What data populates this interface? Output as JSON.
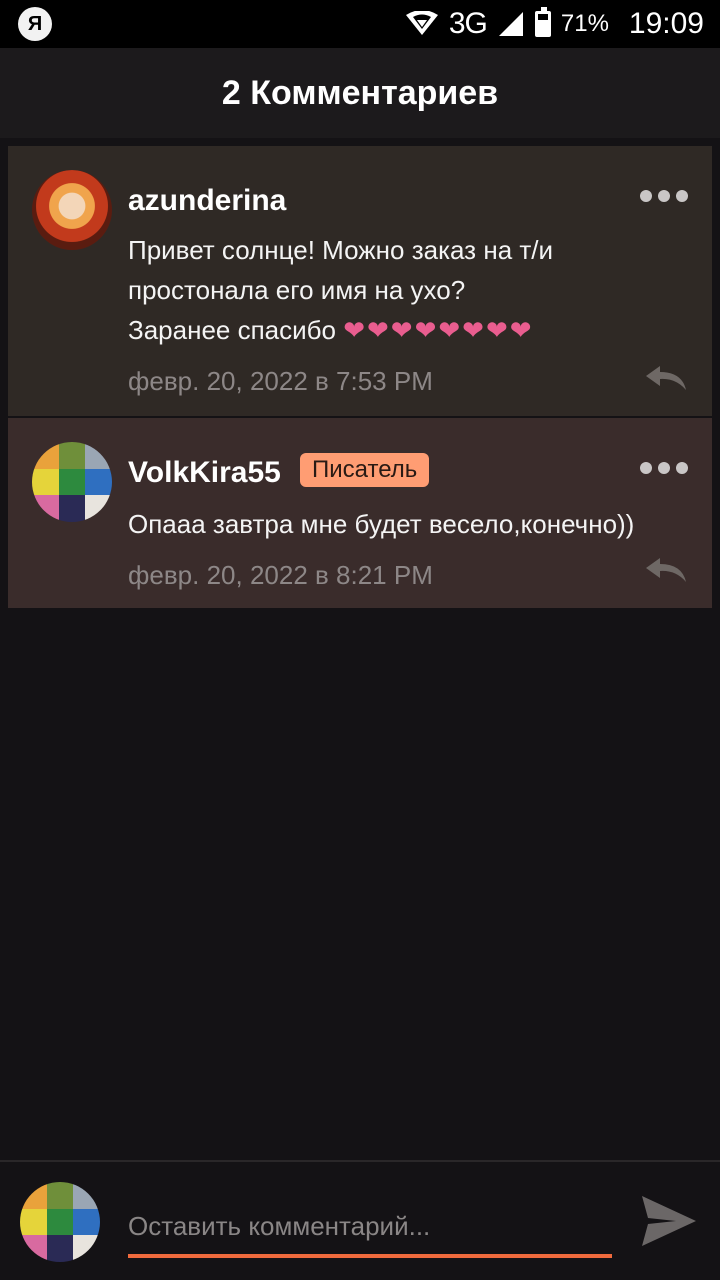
{
  "status_bar": {
    "app_icon_letter": "Я",
    "network": "3G",
    "battery": "71%",
    "time": "19:09"
  },
  "header": {
    "title": "2 Комментариев"
  },
  "comments": [
    {
      "username": "azunderina",
      "text_lines": [
        "Привет солнце! Можно заказ на т/и",
        "простонала его имя на ухо?",
        "Заранее спасибо"
      ],
      "hearts": "❤❤❤❤❤❤❤❤",
      "date": "февр. 20, 2022 в 7:53 PM"
    },
    {
      "username": "VolkKira55",
      "badge": "Писатель",
      "text_lines": [
        "Опааа завтра мне будет весело,конечно))"
      ],
      "date": "февр. 20, 2022 в 8:21 PM"
    }
  ],
  "input": {
    "placeholder": "Оставить комментарий..."
  },
  "colors": {
    "accent": "#f06a3d",
    "badge": "#ff9d73",
    "heart": "#e95d8f"
  }
}
